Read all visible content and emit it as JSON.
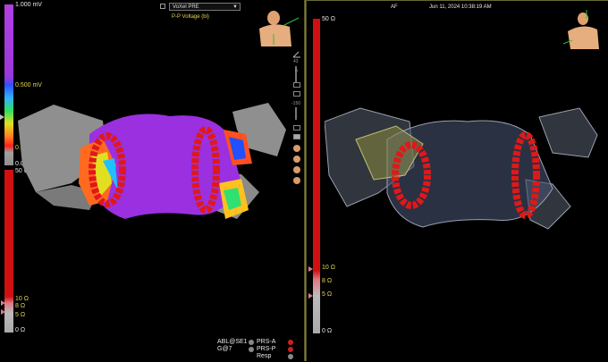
{
  "left": {
    "map_select": {
      "value": "VoXel PRE"
    },
    "map_type_label": "P-P Voltage (bi)",
    "voltage_scale": {
      "max": "1.000 mV",
      "mid": "0.500 mV",
      "low": "0.100 mV",
      "min": "0.000 mV"
    },
    "impedance_scale": {
      "top": "50 Ω",
      "mark_10": "10 Ω",
      "mark_8": "8 Ω",
      "mark_5": "5 Ω",
      "bottom": "0 Ω"
    },
    "toolbar": {
      "angle_value": "43",
      "zero_value": "0",
      "depth_value": "-150"
    },
    "status": {
      "catheter_1": "ABL@SE1",
      "catheter_2": "G@7",
      "resp_indicators": [
        {
          "label": "PRS-A",
          "color": "#cc2020"
        },
        {
          "label": "PRS-P",
          "color": "#cc2020"
        },
        {
          "label": "Resp",
          "color": "#888888"
        }
      ]
    }
  },
  "right": {
    "rhythm_label": "AF",
    "timestamp": "Jun 11, 2024 10:38:19 AM",
    "impedance_scale": {
      "top": "50 Ω",
      "mark_10": "10 Ω",
      "mark_8": "8 Ω",
      "mark_5": "5 Ω",
      "bottom": "0 Ω"
    }
  },
  "colors": {
    "ablation_lesion": "#e01818",
    "low_voltage": "#9a30e0",
    "chamber_shell": "#8a8a8a"
  }
}
